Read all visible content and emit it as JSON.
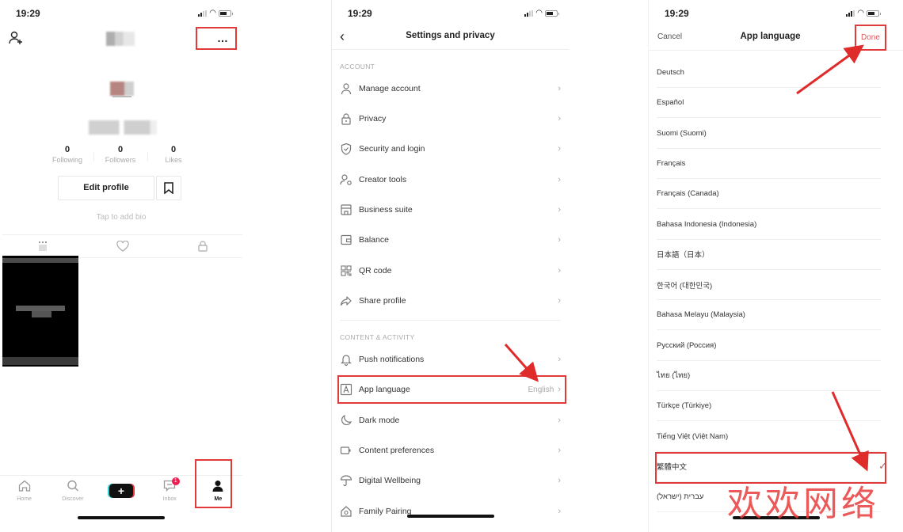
{
  "status_bar": {
    "time": "19:29"
  },
  "profile": {
    "more_icon": "…",
    "stats": [
      {
        "value": "0",
        "label": "Following"
      },
      {
        "value": "0",
        "label": "Followers"
      },
      {
        "value": "0",
        "label": "Likes"
      }
    ],
    "edit_profile_label": "Edit profile",
    "bio_placeholder": "Tap to add bio",
    "nav": [
      {
        "label": "Home",
        "icon": "home-icon"
      },
      {
        "label": "Discover",
        "icon": "search-icon"
      },
      {
        "label": "",
        "icon": "plus-icon",
        "glyph": "+"
      },
      {
        "label": "Inbox",
        "icon": "inbox-icon",
        "badge": "1"
      },
      {
        "label": "Me",
        "icon": "person-icon"
      }
    ]
  },
  "settings": {
    "title": "Settings and privacy",
    "back_glyph": "‹",
    "sections": [
      {
        "label": "ACCOUNT",
        "items": [
          {
            "label": "Manage account",
            "icon": "person-icon"
          },
          {
            "label": "Privacy",
            "icon": "lock-icon"
          },
          {
            "label": "Security and login",
            "icon": "shield-icon"
          },
          {
            "label": "Creator tools",
            "icon": "creator-icon"
          },
          {
            "label": "Business suite",
            "icon": "store-icon"
          },
          {
            "label": "Balance",
            "icon": "wallet-icon"
          },
          {
            "label": "QR code",
            "icon": "qr-code-icon"
          },
          {
            "label": "Share profile",
            "icon": "share-icon"
          }
        ]
      },
      {
        "label": "CONTENT & ACTIVITY",
        "items": [
          {
            "label": "Push notifications",
            "icon": "bell-icon"
          },
          {
            "label": "App language",
            "icon": "language-icon",
            "value": "English"
          },
          {
            "label": "Dark mode",
            "icon": "moon-icon"
          },
          {
            "label": "Content preferences",
            "icon": "video-icon"
          },
          {
            "label": "Digital Wellbeing",
            "icon": "umbrella-icon"
          },
          {
            "label": "Family Pairing",
            "icon": "house-icon"
          }
        ]
      }
    ],
    "chevron": "›"
  },
  "app_language": {
    "title": "App language",
    "cancel_label": "Cancel",
    "done_label": "Done",
    "check_glyph": "✓",
    "languages": [
      {
        "label": "Deutsch"
      },
      {
        "label": "Español"
      },
      {
        "label": "Suomi (Suomi)"
      },
      {
        "label": "Français"
      },
      {
        "label": "Français (Canada)"
      },
      {
        "label": "Bahasa Indonesia (Indonesia)"
      },
      {
        "label": "日本語（日本）"
      },
      {
        "label": "한국어 (대한민국)"
      },
      {
        "label": "Bahasa Melayu (Malaysia)"
      },
      {
        "label": "Русский (Россия)"
      },
      {
        "label": "ไทย (ไทย)"
      },
      {
        "label": "Türkçe (Türkiye)"
      },
      {
        "label": "Tiếng Việt (Việt Nam)"
      },
      {
        "label": "繁體中文",
        "selected": true
      },
      {
        "label": "עברית (ישראל)"
      }
    ]
  },
  "watermark": "欢欢网络",
  "colors": {
    "highlight": "#e03a3a",
    "done": "#e0595f",
    "badge": "#ee1d52"
  }
}
